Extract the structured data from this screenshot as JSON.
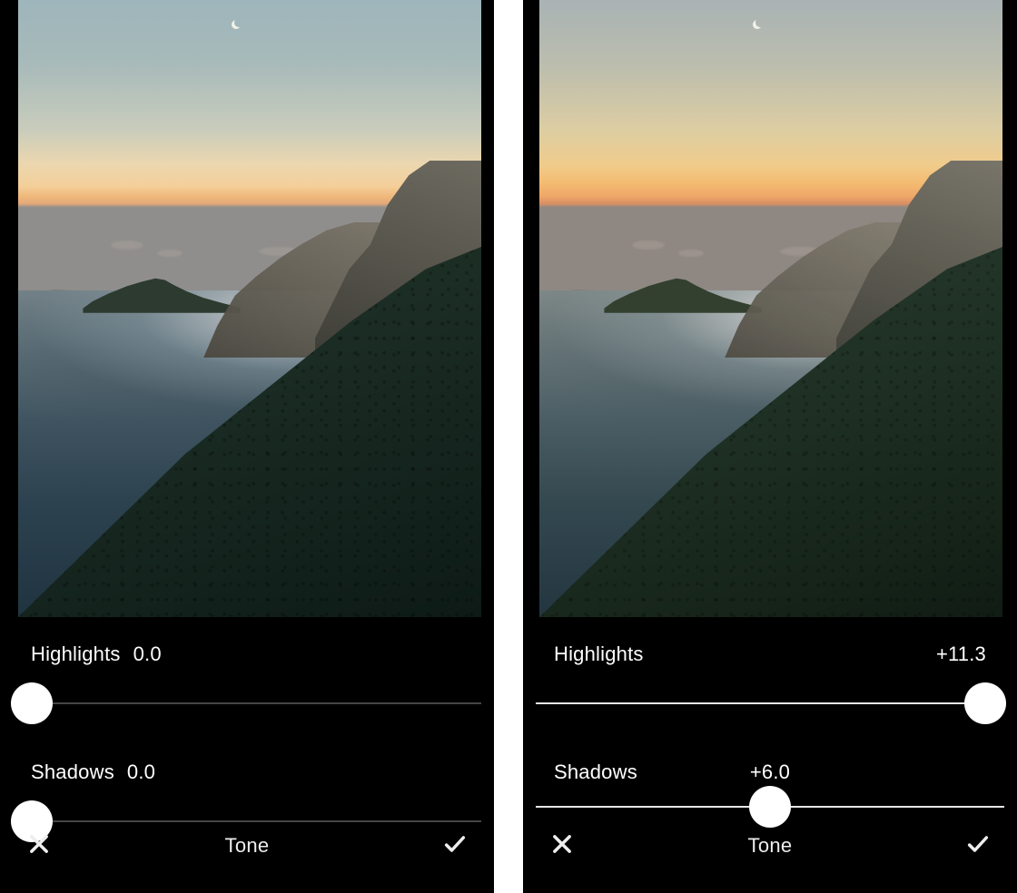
{
  "panels": [
    {
      "highlights": {
        "label": "Highlights",
        "value": "0.0",
        "pct": 4,
        "value_align": "near"
      },
      "shadows": {
        "label": "Shadows",
        "value": "0.0",
        "pct": 4,
        "value_align": "near"
      },
      "footer": {
        "title": "Tone"
      },
      "track_class": ""
    },
    {
      "highlights": {
        "label": "Highlights",
        "value": "+11.3",
        "pct": 96,
        "value_align": "far"
      },
      "shadows": {
        "label": "Shadows",
        "value": "+6.0",
        "pct": 50,
        "value_align": "at"
      },
      "footer": {
        "title": "Tone"
      },
      "track_class": "bright"
    }
  ],
  "icons": {
    "close": "close-icon",
    "confirm": "check-icon"
  }
}
